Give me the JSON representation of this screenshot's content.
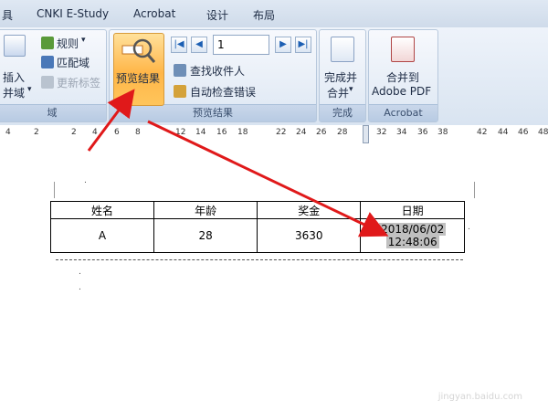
{
  "tabs": [
    "具",
    "CNKI E-Study",
    "Acrobat",
    "设计",
    "布局"
  ],
  "ribbon": {
    "write_insert": {
      "insert_label_1": "插入",
      "insert_label_2": "并域",
      "rules": "规则",
      "match_fields": "匹配域",
      "update_labels": "更新标签",
      "group_label": "域"
    },
    "preview": {
      "preview_button": "预览结果",
      "record_number": "1",
      "find_recipient": "查找收件人",
      "auto_check": "自动检查错误",
      "group_label": "预览结果"
    },
    "finish": {
      "label_1": "完成并",
      "label_2": "合并",
      "group_label": "完成"
    },
    "acrobat": {
      "label_1": "合并到",
      "label_2": "Adobe PDF",
      "group_label": "Acrobat"
    }
  },
  "ruler_ticks": [
    "4",
    "2",
    "2",
    "4",
    "6",
    "8",
    "12",
    "14",
    "16",
    "18",
    "22",
    "24",
    "26",
    "28",
    "32",
    "34",
    "36",
    "38",
    "42",
    "44",
    "46",
    "48"
  ],
  "table": {
    "headers": [
      "姓名",
      "年龄",
      "奖金",
      "日期"
    ],
    "row": {
      "name": "A",
      "age": "28",
      "bonus": "3630",
      "date_line1": "2018/06/02",
      "date_line2": "12:48:06"
    }
  },
  "watermark": "jingyan.baidu.com",
  "colors": {
    "arrow": "#e0191a",
    "preview_button_bg": "#ffb648",
    "ribbon_bg": "#dde7f3"
  }
}
